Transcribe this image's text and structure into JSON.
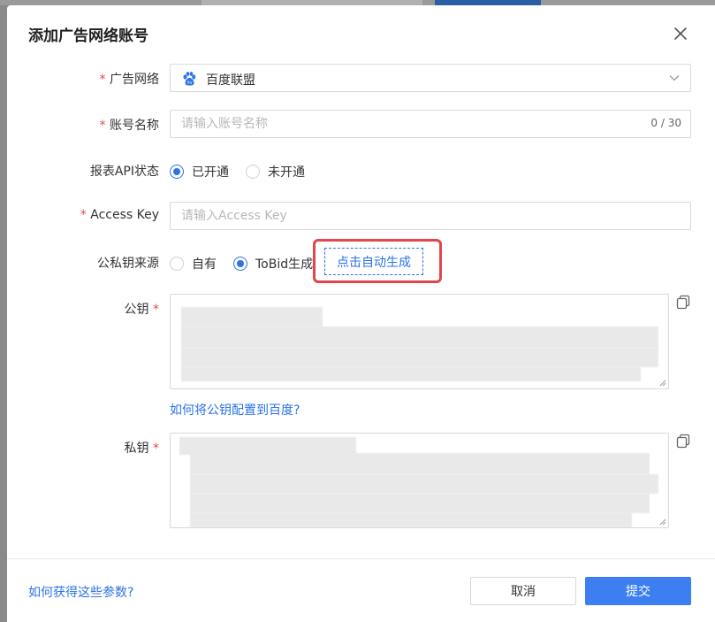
{
  "dialog": {
    "title": "添加广告网络账号"
  },
  "form": {
    "ad_network": {
      "required_mark": "*",
      "label": "广告网络",
      "value": "百度联盟",
      "icon": "baidu-paw-icon"
    },
    "account_name": {
      "required_mark": "*",
      "label": "账号名称",
      "placeholder": "请输入账号名称",
      "value": "",
      "counter": "0 / 30"
    },
    "report_api": {
      "label": "报表API状态",
      "options": [
        {
          "label": "已开通",
          "selected": true
        },
        {
          "label": "未开通",
          "selected": false
        }
      ]
    },
    "access_key": {
      "required_mark": "*",
      "label": "Access Key",
      "placeholder": "请输入Access Key",
      "value": ""
    },
    "key_source": {
      "label": "公私钥来源",
      "options": [
        {
          "label": "自有",
          "selected": false
        },
        {
          "label": "ToBid生成",
          "selected": true
        }
      ],
      "generate_button": "点击自动生成"
    },
    "public_key": {
      "label": "公钥",
      "required_mark": "*",
      "help_link": "如何将公钥配置到百度?"
    },
    "private_key": {
      "label": "私钥",
      "required_mark": "*"
    }
  },
  "footer": {
    "help_link": "如何获得这些参数?",
    "cancel": "取消",
    "submit": "提交"
  },
  "colors": {
    "accent": "#2b73e8",
    "primary_button": "#3d7ef0",
    "required": "#e5484d",
    "highlight": "#e0464c"
  }
}
